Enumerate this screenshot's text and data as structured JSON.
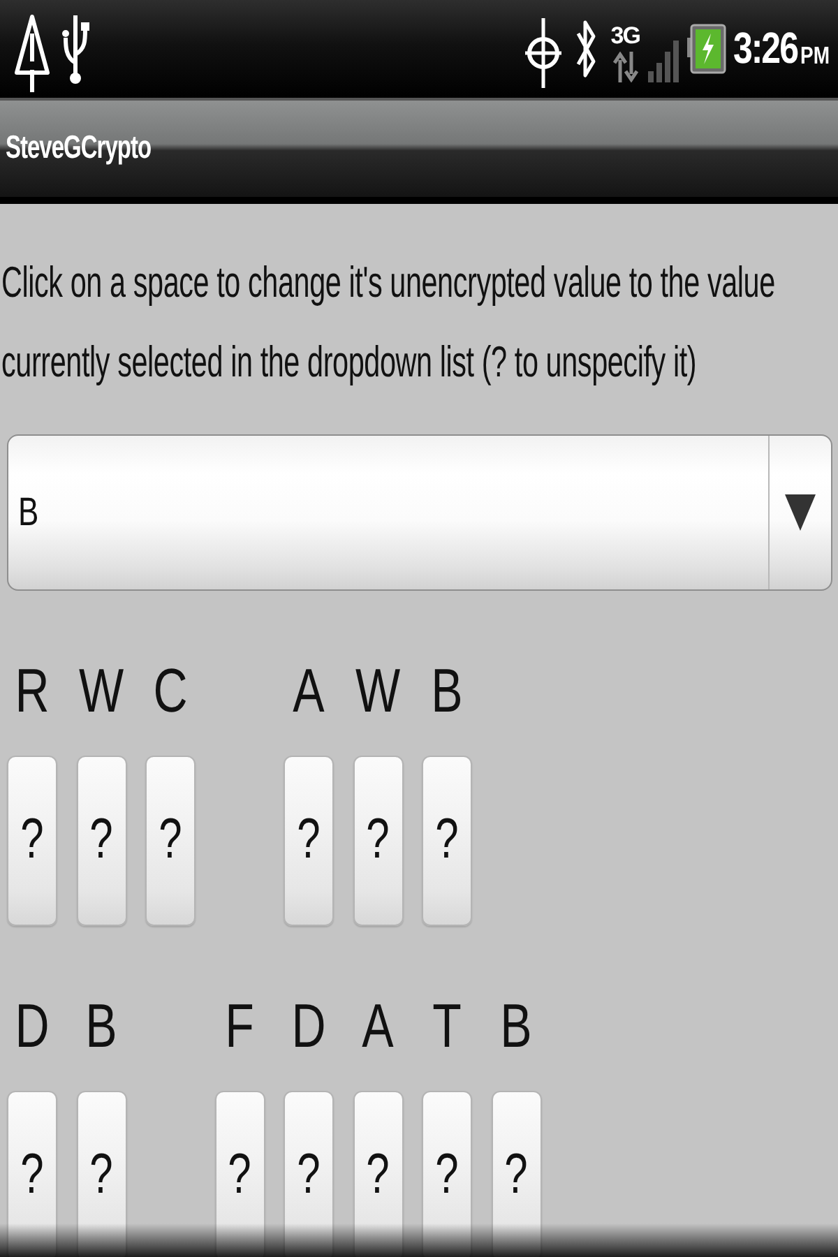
{
  "status_bar": {
    "network": "3G",
    "time": "3:26",
    "meridiem": "PM"
  },
  "title_bar": {
    "title": "SteveGCrypto"
  },
  "instructions": "Click on a space to change it's unencrypted value to the value currently selected in the dropdown list (? to unspecify it)",
  "dropdown": {
    "value": "B"
  },
  "puzzle": {
    "rows": [
      {
        "words": [
          {
            "letters": [
              {
                "cipher": "R",
                "plain": "?"
              },
              {
                "cipher": "W",
                "plain": "?"
              },
              {
                "cipher": "C",
                "plain": "?"
              }
            ]
          },
          {
            "letters": [
              {
                "cipher": "A",
                "plain": "?"
              },
              {
                "cipher": "W",
                "plain": "?"
              },
              {
                "cipher": "B",
                "plain": "?"
              }
            ]
          }
        ]
      },
      {
        "words": [
          {
            "letters": [
              {
                "cipher": "D",
                "plain": "?"
              },
              {
                "cipher": "B",
                "plain": "?"
              }
            ]
          },
          {
            "letters": [
              {
                "cipher": "F",
                "plain": "?"
              },
              {
                "cipher": "D",
                "plain": "?"
              },
              {
                "cipher": "A",
                "plain": "?"
              },
              {
                "cipher": "T",
                "plain": "?"
              },
              {
                "cipher": "B",
                "plain": "?"
              }
            ]
          }
        ]
      }
    ]
  }
}
